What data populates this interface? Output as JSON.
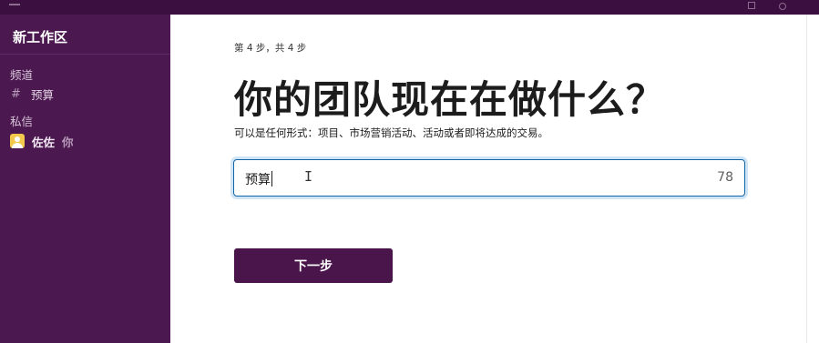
{
  "sidebar": {
    "workspace_name": "新工作区",
    "channels_label": "频道",
    "channels": [
      {
        "label": "预算"
      }
    ],
    "dm_label": "私信",
    "dms": [
      {
        "name": "佐佐",
        "suffix": "你"
      }
    ]
  },
  "main": {
    "step_text": "第 4 步，共 4 步",
    "headline": "你的团队现在在做什么？",
    "subtitle": "可以是任何形式：项目、市场营销活动、活动或者即将达成的交易。",
    "input_value": "预算",
    "char_count": "78",
    "next_button_label": "下一步"
  },
  "icons": {
    "channel": "hash-icon",
    "avatar": "user-avatar-icon",
    "text_cursor": "i-beam-cursor-icon"
  },
  "colors": {
    "sidebar_bg": "#4b1850",
    "titlebar_bg": "#3b0f3f",
    "button_bg": "#4a154b",
    "input_focus_border": "#1264a3",
    "avatar_bg": "#f2c94c"
  }
}
